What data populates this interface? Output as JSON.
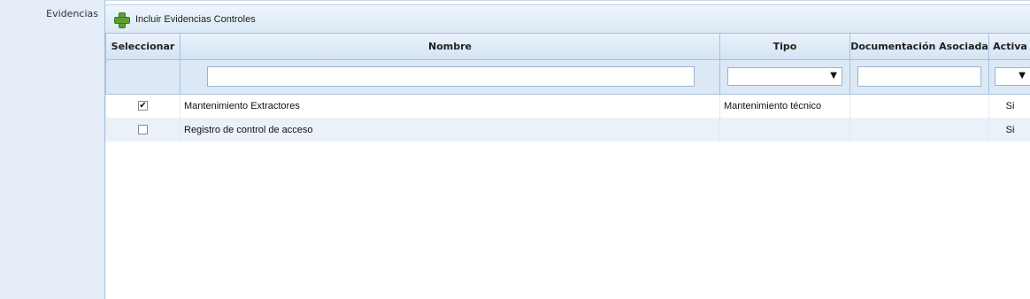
{
  "field_label": "Evidencias",
  "toolbar": {
    "add_label": "Incluir Evidencias Controles",
    "add_icon": "plus-icon"
  },
  "columns": [
    "Seleccionar",
    "Nombre",
    "Tipo",
    "Documentación Asociada",
    "Activa"
  ],
  "filters": {
    "nombre": "",
    "tipo": "",
    "documentacion": "",
    "activa": ""
  },
  "rows": [
    {
      "selected": true,
      "check_glyph": "✔",
      "nombre": "Mantenimiento Extractores",
      "tipo": "Mantenimiento técnico",
      "documentacion": "",
      "activa": "Si"
    },
    {
      "selected": false,
      "check_glyph": "",
      "nombre": "Registro de control de acceso",
      "tipo": "",
      "documentacion": "",
      "activa": "Si"
    }
  ],
  "colors": {
    "panel_bg": "#e4edf8",
    "header_bg": "#d4e3f4",
    "alt_row_bg": "#eaf1f9",
    "border": "#a6c0dd",
    "add_icon_green": "#5aa032"
  }
}
